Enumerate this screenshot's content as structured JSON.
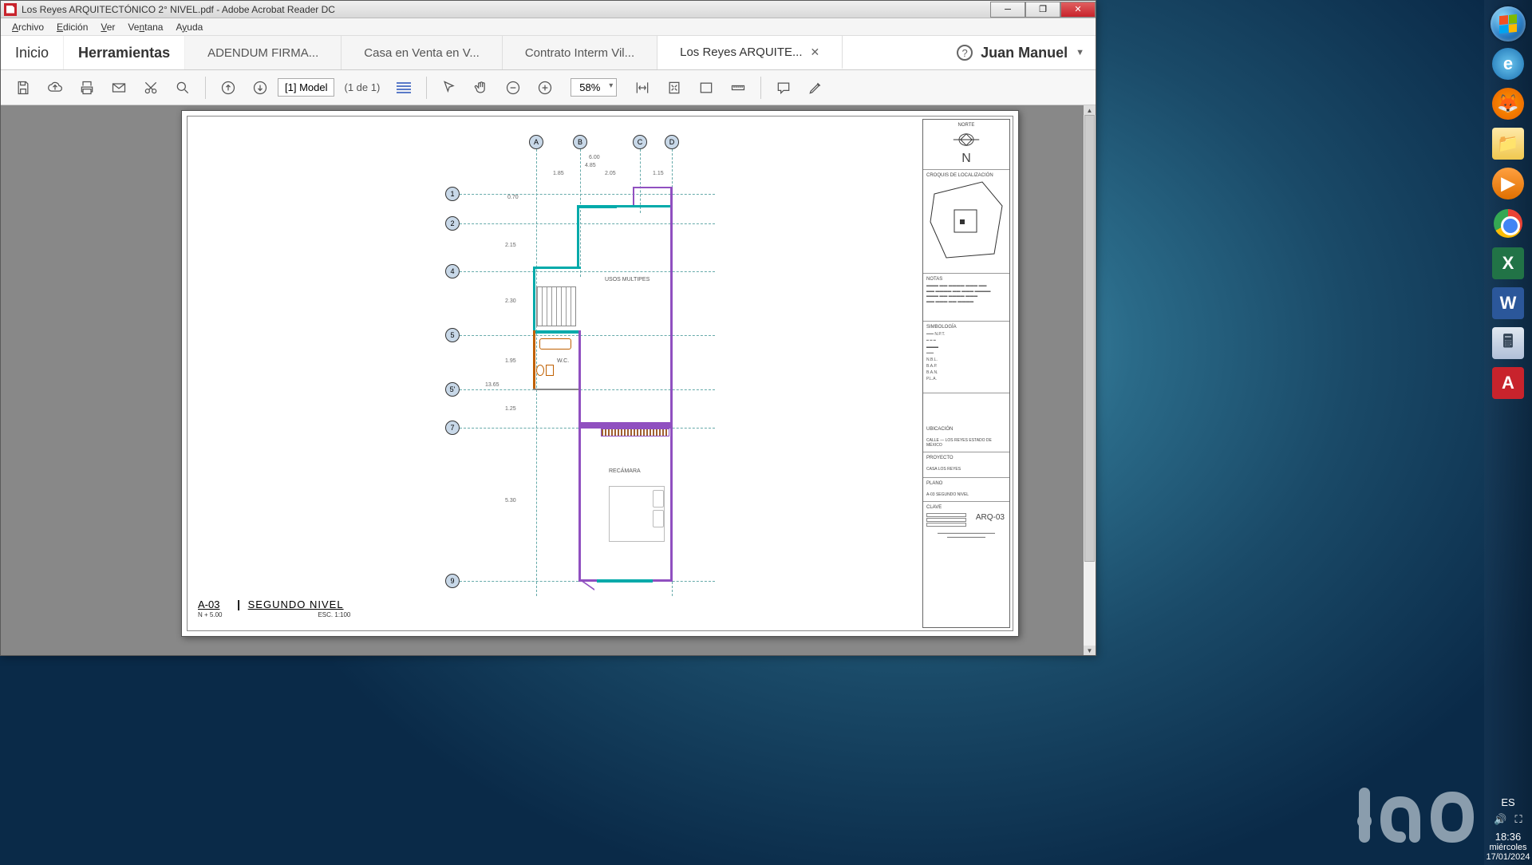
{
  "window": {
    "title": "Los Reyes ARQUITECTÓNICO 2° NIVEL.pdf - Adobe Acrobat Reader DC"
  },
  "menu": {
    "archivo": "Archivo",
    "edicion": "Edición",
    "ver": "Ver",
    "ventana": "Ventana",
    "ayuda": "Ayuda"
  },
  "tabs": {
    "inicio": "Inicio",
    "herramientas": "Herramientas",
    "docs": [
      {
        "label": "ADENDUM FIRMA..."
      },
      {
        "label": "Casa en Venta en V..."
      },
      {
        "label": "Contrato Interm Vil..."
      },
      {
        "label": "Los Reyes ARQUITE...",
        "active": true
      }
    ],
    "user": "Juan Manuel"
  },
  "toolbar": {
    "layer": "[1] Model",
    "page_of": "(1 de 1)",
    "zoom": "58%"
  },
  "floorplan": {
    "grid_cols": [
      "A",
      "B",
      "C",
      "D"
    ],
    "grid_rows": [
      "1",
      "2",
      "4",
      "5",
      "5'",
      "7",
      "9"
    ],
    "dims_top": {
      "total": "6.00",
      "sub_total": "4.85",
      "a": "1.85",
      "b": "2.05",
      "c": "1.15"
    },
    "dims_left": {
      "a": "0.70",
      "b": "2.15",
      "c": "2.30",
      "d": "1.95",
      "e": "13.65",
      "f": "1.25",
      "g": "5.30"
    },
    "rooms": {
      "multi": "USOS MULTIPES",
      "wc": "W.C.",
      "recamara": "RECÁMARA"
    },
    "sheet": {
      "code": "A-03",
      "title": "SEGUNDO NIVEL",
      "level": "N + 5.00",
      "scale": "ESC. 1:100"
    }
  },
  "title_panel": {
    "norte": "NORTE",
    "north": "N",
    "croquis": "CROQUIS DE LOCALIZACIÓN",
    "notas": "NOTAS",
    "simbologia": "SIMBOLOGÍA",
    "ubicacion_h": "UBICACIÓN",
    "ubicacion": "CALLE — LOS REYES ESTADO DE MÉXICO",
    "proyecto_h": "PROYECTO",
    "proyecto": "CASA LOS REYES",
    "plano_h": "PLANO",
    "plano": "A-03 SEGUNDO NIVEL",
    "clave_h": "CLAVE",
    "clave": "ARQ-03"
  },
  "systray": {
    "lang": "ES",
    "time": "18:36",
    "day": "miércoles",
    "date": "17/01/2024"
  }
}
